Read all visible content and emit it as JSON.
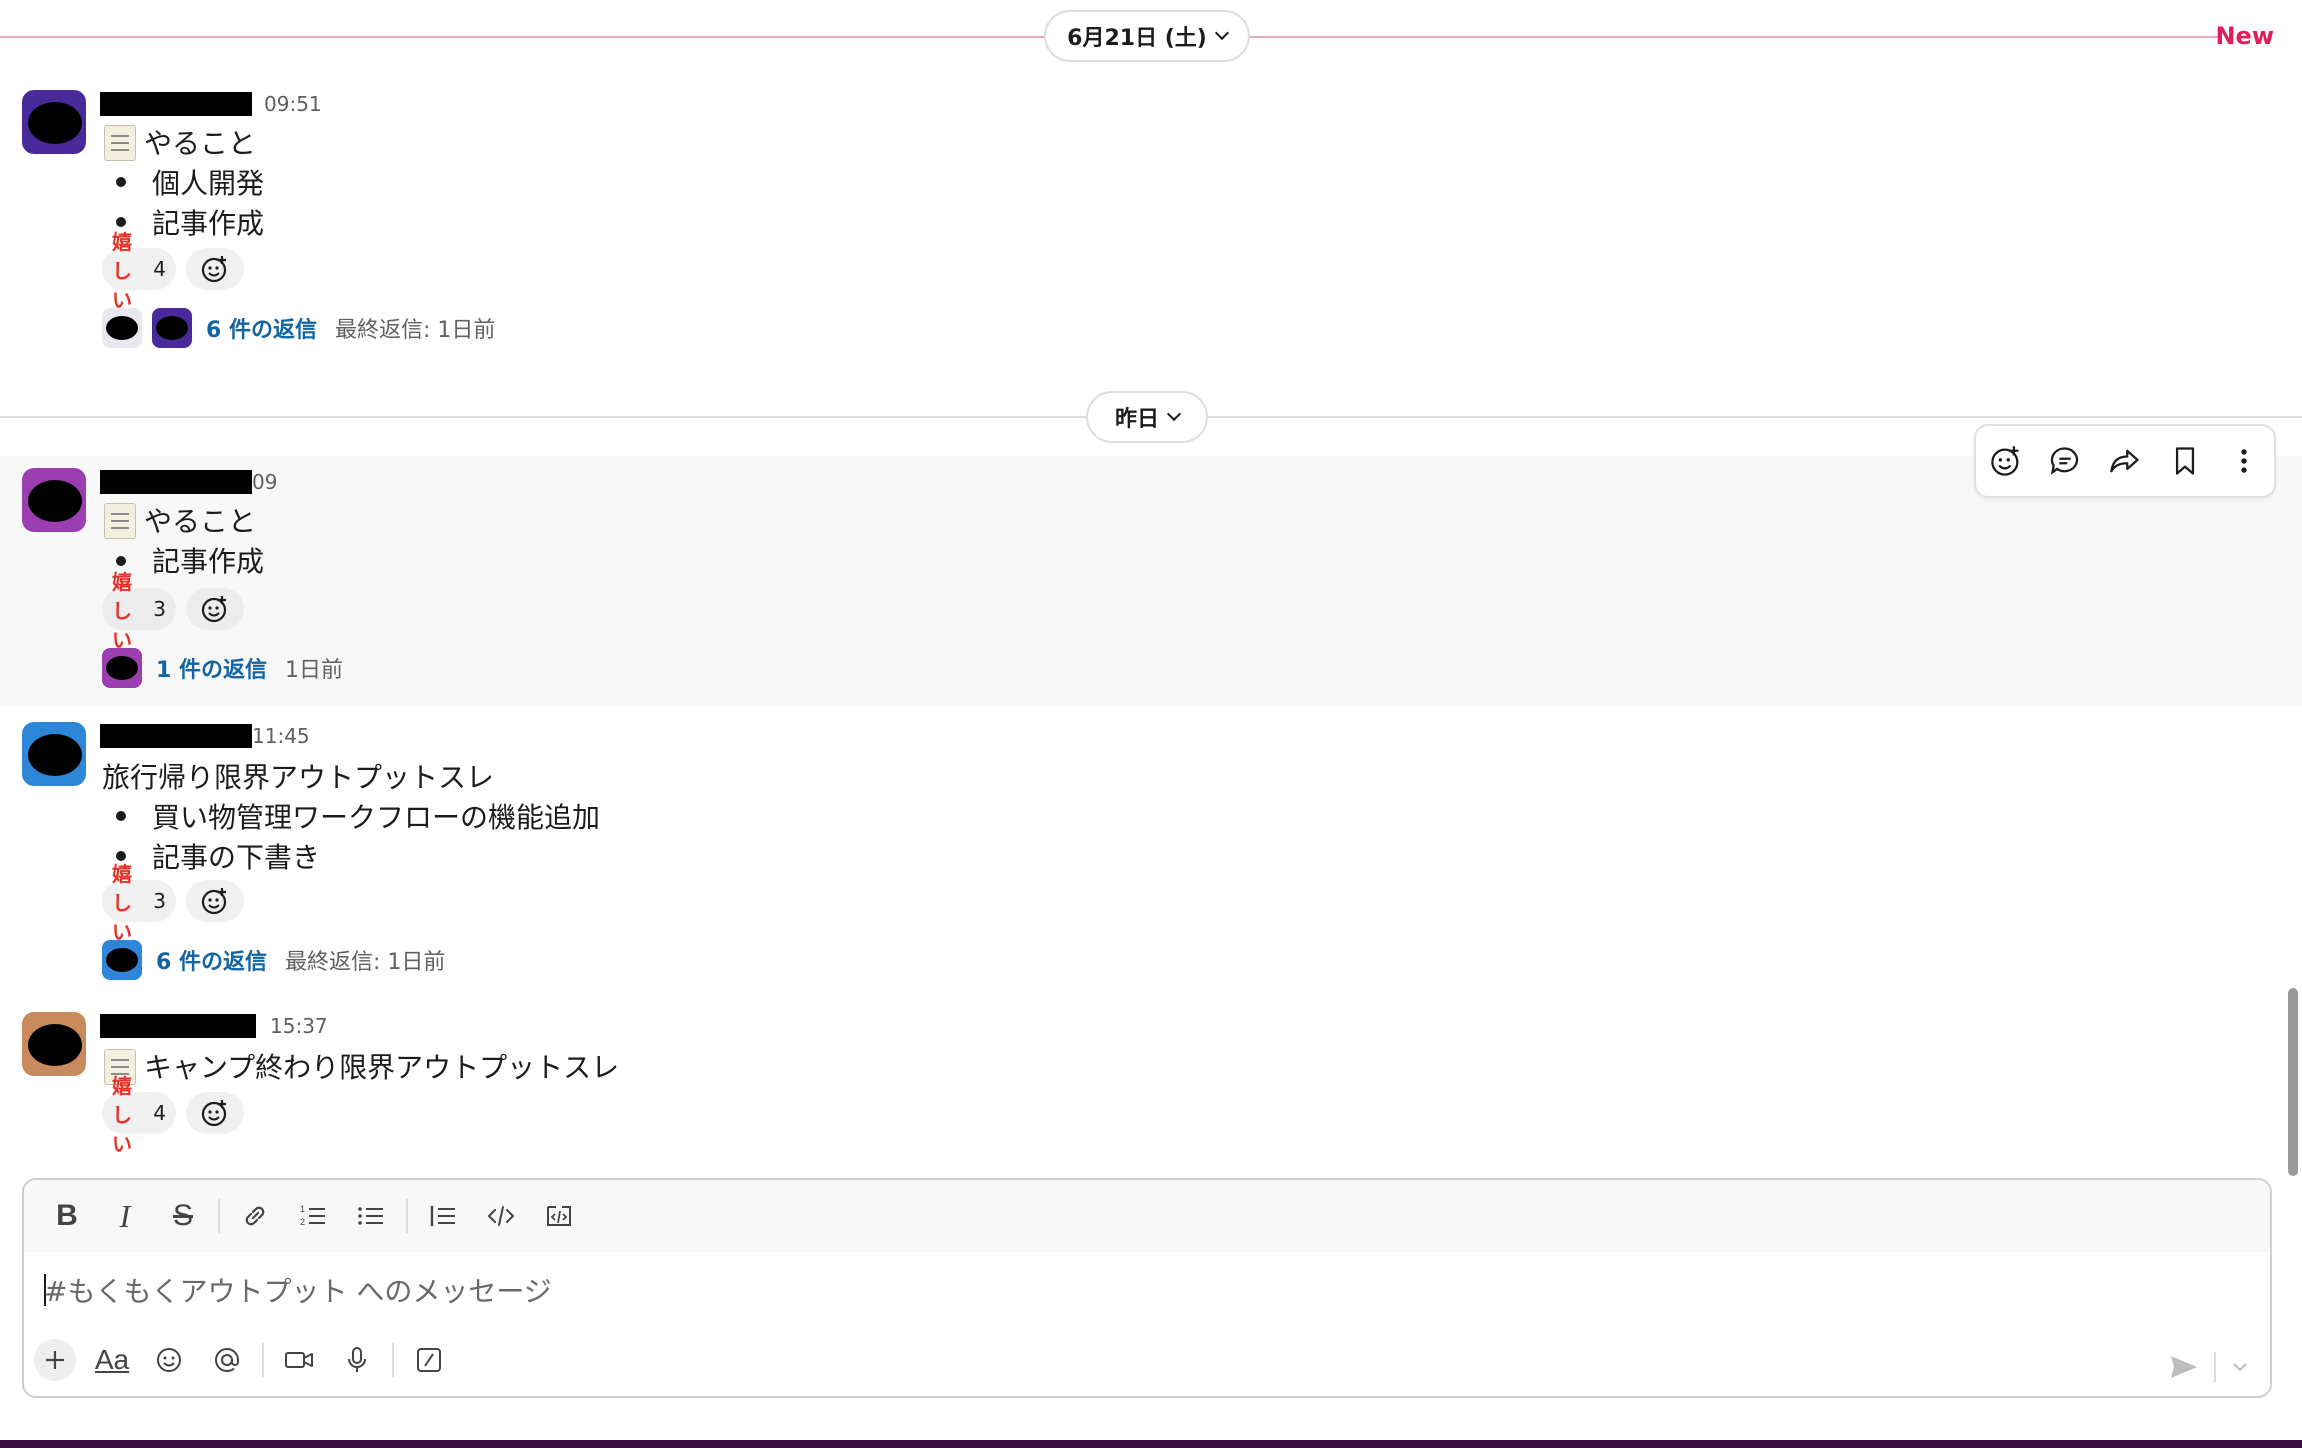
{
  "dividers": {
    "first": {
      "label": "6月21日 (土)",
      "new_label": "New"
    },
    "second": {
      "label": "昨日"
    }
  },
  "messages": [
    {
      "time": "09:51",
      "title": "やること",
      "items": [
        "個人開発",
        "記事作成"
      ],
      "reaction": {
        "emoji": "嬉しい",
        "count": "4"
      },
      "thread": {
        "link": "6 件の返信",
        "meta": "最終返信: 1日前"
      }
    },
    {
      "time": "09",
      "title": "やること",
      "items": [
        "記事作成"
      ],
      "reaction": {
        "emoji": "嬉しい",
        "count": "3"
      },
      "thread": {
        "link": "1 件の返信",
        "meta": "1日前"
      }
    },
    {
      "time": "11:45",
      "title": "旅行帰り限界アウトプットスレ",
      "items": [
        "買い物管理ワークフローの機能追加",
        "記事の下書き"
      ],
      "reaction": {
        "emoji": "嬉しい",
        "count": "3"
      },
      "thread": {
        "link": "6 件の返信",
        "meta": "最終返信: 1日前"
      }
    },
    {
      "time": "15:37",
      "title": "キャンプ終わり限界アウトプットスレ",
      "items": [],
      "reaction": {
        "emoji": "嬉しい",
        "count": "4"
      }
    }
  ],
  "composer": {
    "placeholder": "#もくもくアウトプット へのメッセージ",
    "format_text_label": "Aa"
  },
  "colors": {
    "new_line": "#e01e5a",
    "link": "#1264a3",
    "avatar_purple": "#4a2a9a",
    "avatar_magenta": "#9b3fb0",
    "avatar_blue": "#2d86d8",
    "footer": "#3f0e40"
  },
  "icons": {
    "hover_toolbar": [
      "add-reaction-icon",
      "reply-thread-icon",
      "forward-icon",
      "bookmark-icon",
      "more-actions-icon"
    ],
    "format_bar": [
      "bold-icon",
      "italic-icon",
      "strikethrough-icon",
      "link-icon",
      "ordered-list-icon",
      "bullet-list-icon",
      "blockquote-icon",
      "code-icon",
      "code-block-icon"
    ],
    "bottom_bar": [
      "plus-icon",
      "format-text-icon",
      "emoji-icon",
      "mention-icon",
      "video-icon",
      "microphone-icon",
      "slash-command-icon",
      "send-icon",
      "chevron-down-icon"
    ]
  }
}
